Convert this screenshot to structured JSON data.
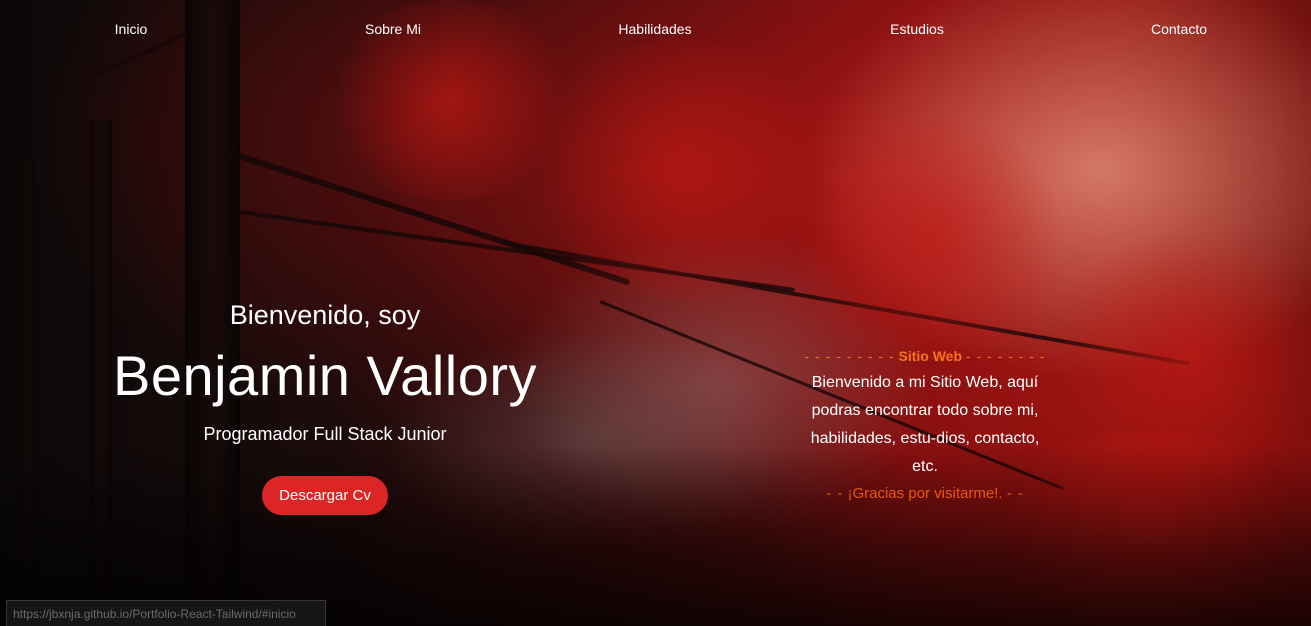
{
  "nav": {
    "items": [
      {
        "label": "Inicio"
      },
      {
        "label": "Sobre Mi"
      },
      {
        "label": "Habilidades"
      },
      {
        "label": "Estudios"
      },
      {
        "label": "Contacto"
      }
    ]
  },
  "intro": {
    "greeting": "Bienvenido, soy",
    "name": "Benjamin Vallory",
    "role": "Programador Full Stack Junior",
    "cv_button_label": "Descargar Cv"
  },
  "info": {
    "title_dashes_left": "- - - - - - - - -",
    "title": "Sitio Web",
    "title_dashes_right": "- - - - - - - -",
    "body": "Bienvenido a mi Sitio Web, aquí podras encontrar todo sobre mi, habilidades, estu-dios, contacto, etc.",
    "foot_dashes_left": "- -",
    "footer": "¡Gracias por visitarme!.",
    "foot_dashes_right": "- -"
  },
  "status_bar": {
    "url": "https://jbxnja.github.io/Portfolio-React-Tailwind/#inicio"
  },
  "colors": {
    "accent_button": "#dc2626",
    "accent_text": "#f97316"
  }
}
